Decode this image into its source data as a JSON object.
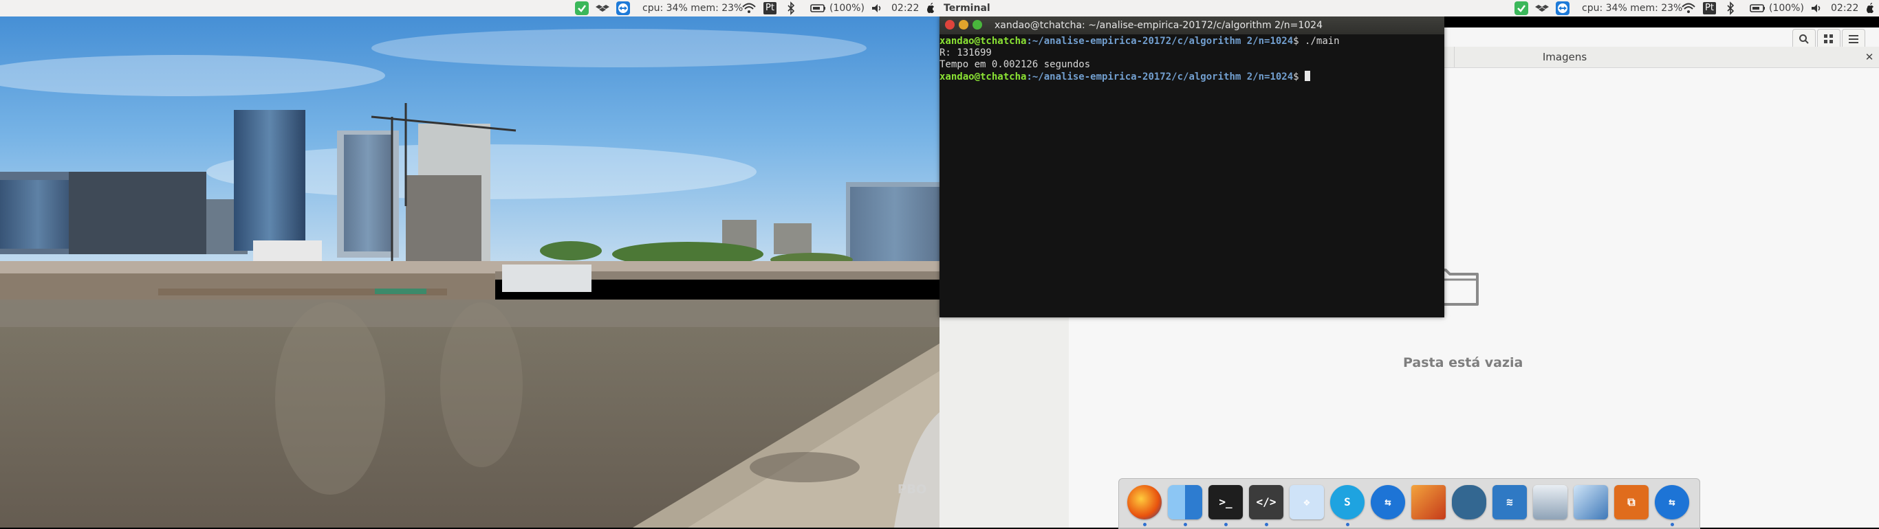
{
  "top_panel": {
    "stats": "cpu: 34% mem: 23%",
    "keyboard_layout": "Pt",
    "battery": "(100%)",
    "clock": "02:22",
    "active_app": "Terminal"
  },
  "terminal": {
    "title": "xandao@tchatcha: ~/analise-empirica-20172/c/algorithm 2/n=1024",
    "lines": [
      {
        "user": "xandao@tchatcha",
        "path": ":~/analise-empirica-20172/c/algorithm 2/n=1024",
        "cmd": "$ ./main"
      },
      {
        "text": "R: 131699"
      },
      {
        "text": "Tempo em 0.002126 segundos"
      },
      {
        "user": "xandao@tchatcha",
        "path": ":~/analise-empirica-20172/c/algorithm 2/n=1024",
        "cmd": "$ "
      }
    ]
  },
  "file_manager": {
    "tab_active_label": "Imagens",
    "empty_message": "Pasta está vazia"
  },
  "wallpaper": {
    "watermark": "PBO"
  },
  "dock": {
    "apps": [
      "firefox-icon",
      "finder-icon",
      "terminal-icon",
      "code-editor-icon",
      "dropbox-icon",
      "skype-icon",
      "teamviewer-icon",
      "matlab-icon",
      "postgresql-icon",
      "mysql-workbench-icon",
      "image-viewer-icon",
      "virtualbox-icon",
      "network-icon",
      "teamviewer-2-icon"
    ]
  },
  "colors": {
    "panel_bg": "#f2f1f0",
    "terminal_bg": "#131313",
    "prompt_user": "#8ae234",
    "prompt_path": "#729fcf"
  }
}
